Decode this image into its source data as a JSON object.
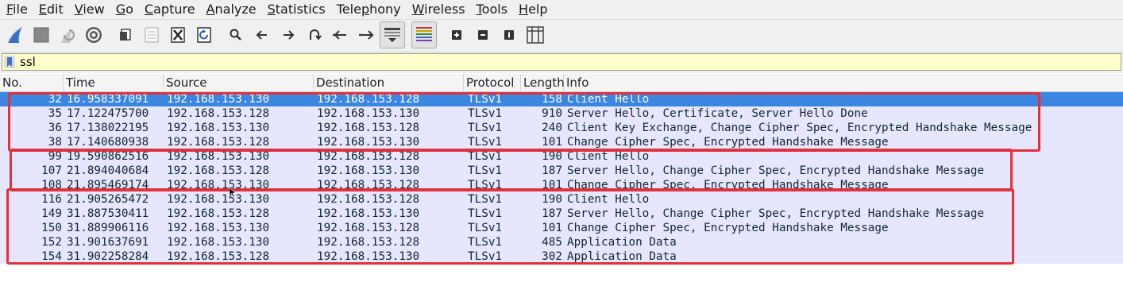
{
  "menu": [
    {
      "u": "F",
      "rest": "ile"
    },
    {
      "u": "E",
      "rest": "dit"
    },
    {
      "u": "V",
      "rest": "iew"
    },
    {
      "u": "G",
      "rest": "o"
    },
    {
      "u": "C",
      "rest": "apture"
    },
    {
      "u": "A",
      "rest": "nalyze"
    },
    {
      "u": "S",
      "rest": "tatistics"
    },
    {
      "u": "",
      "rest": "Telephony",
      "u2": "p"
    },
    {
      "u": "W",
      "rest": "ireless"
    },
    {
      "u": "T",
      "rest": "ools"
    },
    {
      "u": "H",
      "rest": "elp"
    }
  ],
  "toolbar_icons": [
    "shark-fin-icon",
    "stop-icon",
    "restart-icon",
    "options-gear-icon",
    "open-file-icon",
    "save-file-icon",
    "close-file-icon",
    "reload-file-icon",
    "find-icon",
    "go-back-icon",
    "go-forward-icon",
    "go-to-packet-icon",
    "first-packet-icon",
    "last-packet-icon",
    "autoscroll-icon",
    "colorize-icon",
    "zoom-in-icon",
    "zoom-out-icon",
    "normal-size-icon",
    "resize-columns-icon"
  ],
  "filter": {
    "value": "ssl",
    "background": "#ffffcc"
  },
  "columns": [
    "No.",
    "Time",
    "Source",
    "Destination",
    "Protocol",
    "Length",
    "Info"
  ],
  "packets": [
    {
      "no": "32",
      "time": "16.958337091",
      "src": "192.168.153.130",
      "dst": "192.168.153.128",
      "proto": "TLSv1",
      "len": "158",
      "info": "Client Hello"
    },
    {
      "no": "35",
      "time": "17.122475700",
      "src": "192.168.153.128",
      "dst": "192.168.153.130",
      "proto": "TLSv1",
      "len": "910",
      "info": "Server Hello, Certificate, Server Hello Done"
    },
    {
      "no": "36",
      "time": "17.138022195",
      "src": "192.168.153.130",
      "dst": "192.168.153.128",
      "proto": "TLSv1",
      "len": "240",
      "info": "Client Key Exchange, Change Cipher Spec, Encrypted Handshake Message"
    },
    {
      "no": "38",
      "time": "17.140680938",
      "src": "192.168.153.128",
      "dst": "192.168.153.130",
      "proto": "TLSv1",
      "len": "101",
      "info": "Change Cipher Spec, Encrypted Handshake Message"
    },
    {
      "no": "99",
      "time": "19.590862516",
      "src": "192.168.153.130",
      "dst": "192.168.153.128",
      "proto": "TLSv1",
      "len": "190",
      "info": "Client Hello"
    },
    {
      "no": "107",
      "time": "21.894040684",
      "src": "192.168.153.128",
      "dst": "192.168.153.130",
      "proto": "TLSv1",
      "len": "187",
      "info": "Server Hello, Change Cipher Spec, Encrypted Handshake Message"
    },
    {
      "no": "108",
      "time": "21.895469174",
      "src": "192.168.153.130",
      "dst": "192.168.153.128",
      "proto": "TLSv1",
      "len": "101",
      "info": "Change Cipher Spec, Encrypted Handshake Message"
    },
    {
      "no": "116",
      "time": "21.905265472",
      "src": "192.168.153.130",
      "dst": "192.168.153.128",
      "proto": "TLSv1",
      "len": "190",
      "info": "Client Hello"
    },
    {
      "no": "149",
      "time": "31.887530411",
      "src": "192.168.153.128",
      "dst": "192.168.153.130",
      "proto": "TLSv1",
      "len": "187",
      "info": "Server Hello, Change Cipher Spec, Encrypted Handshake Message"
    },
    {
      "no": "150",
      "time": "31.889906116",
      "src": "192.168.153.130",
      "dst": "192.168.153.128",
      "proto": "TLSv1",
      "len": "101",
      "info": "Change Cipher Spec, Encrypted Handshake Message"
    },
    {
      "no": "152",
      "time": "31.901637691",
      "src": "192.168.153.130",
      "dst": "192.168.153.128",
      "proto": "TLSv1",
      "len": "485",
      "info": "Application Data"
    },
    {
      "no": "154",
      "time": "31.902258284",
      "src": "192.168.153.128",
      "dst": "192.168.153.130",
      "proto": "TLSv1",
      "len": "302",
      "info": "Application Data"
    }
  ],
  "selected_packet_no": "32",
  "colors": {
    "row_bg": "#e7e6ff",
    "selected_bg": "#3b86e0",
    "annotation": "#e0323a"
  }
}
